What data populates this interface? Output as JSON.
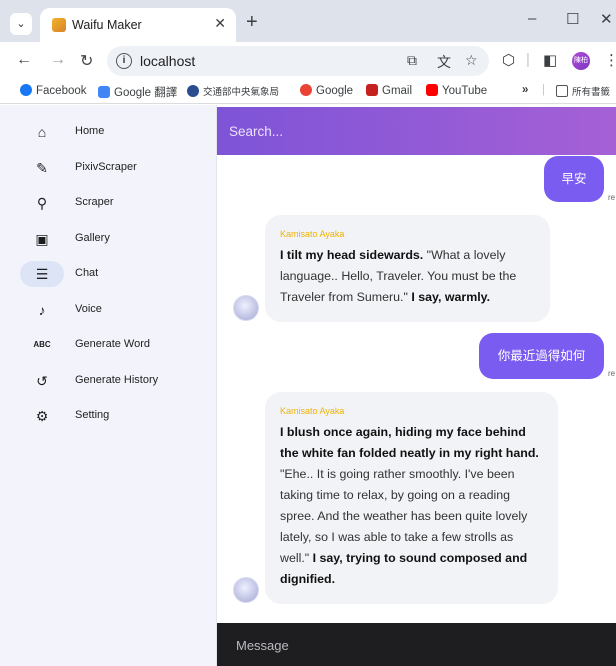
{
  "browser": {
    "tab_title": "Waifu Maker",
    "new_tab": "+",
    "window_controls": [
      "–",
      "☐",
      "✕"
    ],
    "url": "localhost",
    "bookmarks": [
      {
        "label": "Facebook",
        "color": "#1877f2"
      },
      {
        "label": "Google 翻譯",
        "color": "#4285f4"
      },
      {
        "label": "交通部中央氣象局",
        "color": "#2a4d8f"
      },
      {
        "label": "Google",
        "color": "#ea4335"
      },
      {
        "label": "Gmail",
        "color": "#c5221f"
      },
      {
        "label": "YouTube",
        "color": "#ff0000"
      }
    ],
    "more": "»",
    "all_bookmarks": "所有書籤",
    "profile_initials": "陳柏"
  },
  "sidebar": {
    "items": [
      {
        "label": "Home",
        "icon": "home-icon",
        "glyph": "⌂",
        "active": false
      },
      {
        "label": "PixivScraper",
        "icon": "brush-icon",
        "glyph": "✎",
        "active": false
      },
      {
        "label": "Scraper",
        "icon": "search-zoom-icon",
        "glyph": "⚲",
        "active": false
      },
      {
        "label": "Gallery",
        "icon": "image-icon",
        "glyph": "▣",
        "active": false
      },
      {
        "label": "Chat",
        "icon": "chat-icon",
        "glyph": "☰",
        "active": true
      },
      {
        "label": "Voice",
        "icon": "microphone-icon",
        "glyph": "♪",
        "active": false
      },
      {
        "label": "Generate Word",
        "icon": "abc-icon",
        "glyph": "ABC",
        "active": false
      },
      {
        "label": "Generate History",
        "icon": "history-icon",
        "glyph": "↺",
        "active": false
      },
      {
        "label": "Setting",
        "icon": "gear-icon",
        "glyph": "⚙",
        "active": false
      }
    ]
  },
  "chat": {
    "search_placeholder": "Search...",
    "messages": [
      {
        "role": "user",
        "text": "早安",
        "status": "re"
      },
      {
        "role": "ai",
        "sender": "Kamisato Ayaka",
        "parts": [
          {
            "bold": true,
            "text": "I tilt my head sidewards."
          },
          {
            "bold": false,
            "text": " \"What a lovely language.. Hello, Traveler. You must be the Traveler from Sumeru.\" "
          },
          {
            "bold": true,
            "text": "I say, warmly."
          }
        ]
      },
      {
        "role": "user",
        "text": "你最近過得如何",
        "status": "re"
      },
      {
        "role": "ai",
        "sender": "Kamisato Ayaka",
        "parts": [
          {
            "bold": true,
            "text": "I blush once again, hiding my face behind the white fan folded neatly in my right hand."
          },
          {
            "bold": false,
            "text": " \"Ehe.. It is going rather smoothly. I've been taking time to relax, by going on a reading spree. And the weather has been quite lovely lately, so I was able to take a few strolls as well.\" "
          },
          {
            "bold": true,
            "text": "I say, trying to sound composed and dignified."
          }
        ]
      }
    ],
    "message_placeholder": "Message"
  }
}
